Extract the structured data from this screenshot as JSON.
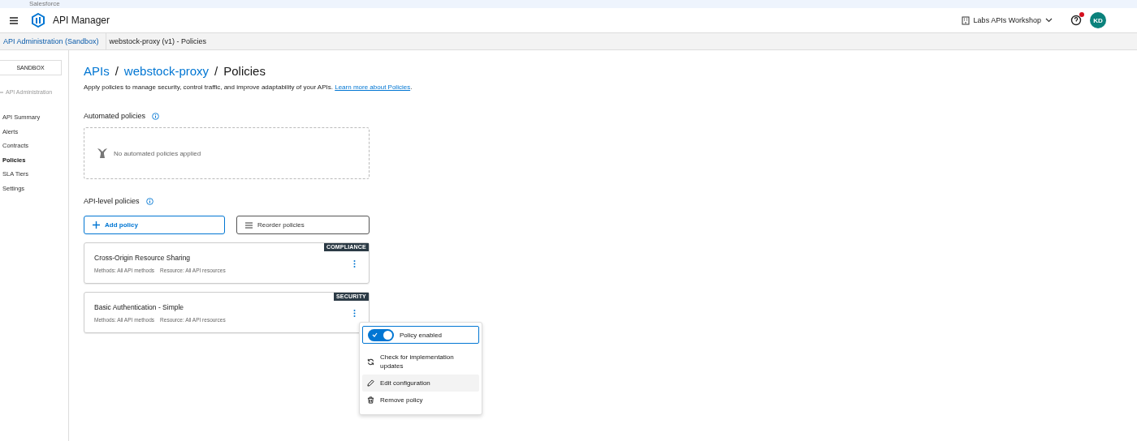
{
  "top_strip": {
    "label": "Salesforce"
  },
  "header": {
    "app_name": "API Manager",
    "org": "Labs APIs Workshop",
    "avatar": "KD",
    "help_notification": true
  },
  "breadcrumb": [
    {
      "label": "API Administration (Sandbox)",
      "link": true
    },
    {
      "label": "webstock-proxy (v1) - Policies",
      "link": false
    }
  ],
  "sidebar": {
    "env": "SANDBOX",
    "back": "API Administration",
    "items": [
      {
        "label": "API Summary",
        "selected": false
      },
      {
        "label": "Alerts",
        "selected": false
      },
      {
        "label": "Contracts",
        "selected": false
      },
      {
        "label": "Policies",
        "selected": true
      },
      {
        "label": "SLA Tiers",
        "selected": false
      },
      {
        "label": "Settings",
        "selected": false
      }
    ]
  },
  "page": {
    "title": [
      {
        "label": "APIs",
        "link": true
      },
      {
        "label": "/",
        "link": false
      },
      {
        "label": "webstock-proxy",
        "link": true
      },
      {
        "label": "/",
        "link": false
      },
      {
        "label": "Policies",
        "link": false
      }
    ],
    "description": "Apply policies to manage security, control traffic, and improve adaptability of your APIs.",
    "learn_more": "Learn more about Policies",
    "learn_more_end": ".",
    "automated": {
      "heading": "Automated policies",
      "empty": "No automated policies applied"
    },
    "api_level": {
      "heading": "API-level policies",
      "add_button": "Add policy",
      "reorder_button": "Reorder policies",
      "policies": [
        {
          "name": "Cross-Origin Resource Sharing",
          "tag": "COMPLIANCE",
          "methods": "Methods: All API methods",
          "resource": "Resource: All API resources"
        },
        {
          "name": "Basic Authentication - Simple",
          "tag": "SECURITY",
          "methods": "Methods: All API methods",
          "resource": "Resource: All API resources"
        }
      ]
    }
  },
  "menu": {
    "items": [
      {
        "kind": "toggle",
        "label": "Policy enabled",
        "on": true,
        "selected": false
      },
      {
        "kind": "action",
        "label": "Check for implementation updates",
        "selected": false
      },
      {
        "kind": "action",
        "label": "Edit configuration",
        "selected": true
      },
      {
        "kind": "action",
        "label": "Remove policy",
        "selected": false
      }
    ]
  }
}
